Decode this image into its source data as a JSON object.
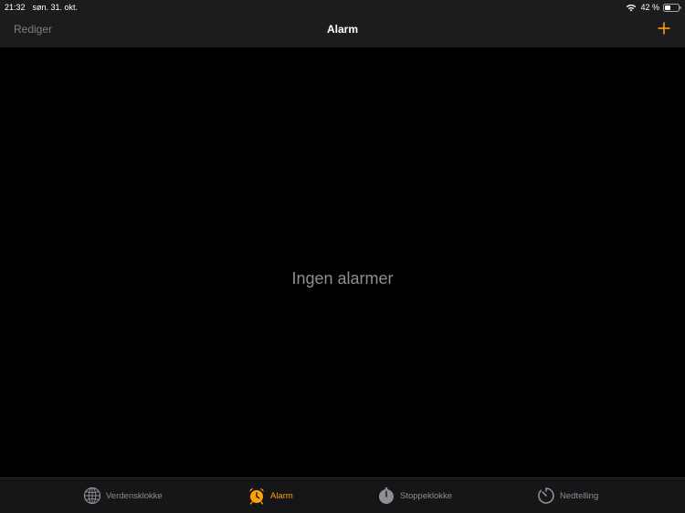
{
  "status_bar": {
    "time": "21:32",
    "date": "søn. 31. okt.",
    "battery": "42 %",
    "icons": [
      "wifi-icon",
      "battery-icon"
    ]
  },
  "nav": {
    "edit_label": "Rediger",
    "title": "Alarm",
    "add_icon": "plus-icon"
  },
  "empty_state": {
    "text": "Ingen alarmer"
  },
  "tabs": [
    {
      "label": "Verdensklokke",
      "icon": "globe-icon",
      "active": false
    },
    {
      "label": "Alarm",
      "icon": "alarm-clock-icon",
      "active": true
    },
    {
      "label": "Stoppeklokke",
      "icon": "stopwatch-icon",
      "active": false
    },
    {
      "label": "Nedtelling",
      "icon": "timer-icon",
      "active": false
    }
  ],
  "colors": {
    "accent": "#ff9f0a",
    "inactive": "#8e8e93",
    "bar_background": "#1c1c1e",
    "background": "#000000"
  }
}
